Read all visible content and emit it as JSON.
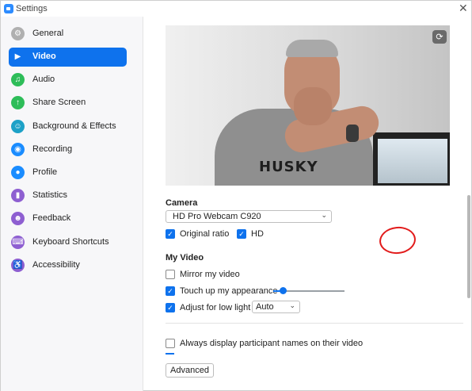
{
  "window": {
    "title": "Settings",
    "close_glyph": "✕"
  },
  "sidebar": {
    "items": [
      {
        "label": "General",
        "icon": "gear-icon",
        "color": "#b0b0b0",
        "glyph": "⚙"
      },
      {
        "label": "Video",
        "icon": "video-camera-icon",
        "color": "#0e72ed",
        "glyph": "▶",
        "active": true
      },
      {
        "label": "Audio",
        "icon": "headphones-icon",
        "color": "#2ebd59",
        "glyph": "♫"
      },
      {
        "label": "Share Screen",
        "icon": "share-screen-icon",
        "color": "#2ebd59",
        "glyph": "↑"
      },
      {
        "label": "Background & Effects",
        "icon": "person-background-icon",
        "color": "#1da1c7",
        "glyph": "☺"
      },
      {
        "label": "Recording",
        "icon": "record-icon",
        "color": "#1a8cff",
        "glyph": "◉"
      },
      {
        "label": "Profile",
        "icon": "profile-icon",
        "color": "#1a8cff",
        "glyph": "●"
      },
      {
        "label": "Statistics",
        "icon": "statistics-icon",
        "color": "#8e5fd1",
        "glyph": "▮"
      },
      {
        "label": "Feedback",
        "icon": "feedback-icon",
        "color": "#8e5fd1",
        "glyph": "☻"
      },
      {
        "label": "Keyboard Shortcuts",
        "icon": "keyboard-icon",
        "color": "#8e5fd1",
        "glyph": "⌨"
      },
      {
        "label": "Accessibility",
        "icon": "accessibility-icon",
        "color": "#8e5fd1",
        "glyph": "♿"
      }
    ]
  },
  "preview": {
    "shirt_text": "HUSKY",
    "toggle_glyph": "⟳"
  },
  "camera": {
    "title": "Camera",
    "device": "HD Pro Webcam C920",
    "original_ratio": {
      "label": "Original ratio",
      "checked": true
    },
    "hd": {
      "label": "HD",
      "checked": true
    }
  },
  "my_video": {
    "title": "My Video",
    "mirror": {
      "label": "Mirror my video",
      "checked": false
    },
    "touch_up": {
      "label": "Touch up my appearance",
      "checked": true,
      "level": 0.13
    },
    "low_light": {
      "label": "Adjust for low light",
      "checked": true,
      "mode": "Auto"
    }
  },
  "names": {
    "label": "Always display participant names on their video",
    "checked": false
  },
  "advanced_button": "Advanced",
  "annotation": {
    "color": "#e21b1b"
  },
  "check_glyph": "✓",
  "chevron_glyph": "⌄"
}
